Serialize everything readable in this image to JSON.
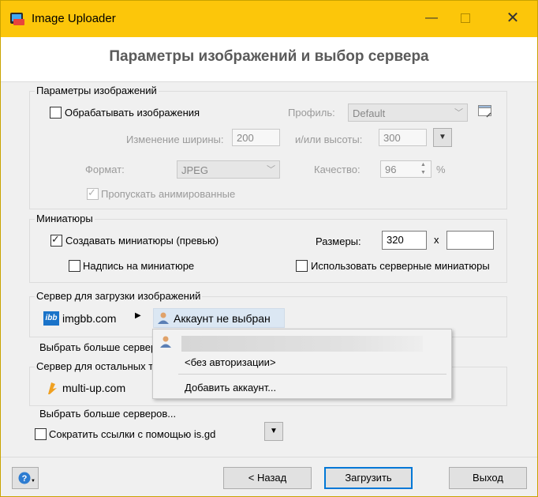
{
  "window": {
    "title": "Image Uploader",
    "minimize_icon": "minimize-icon",
    "maximize_icon": "maximize-icon",
    "close_icon": "close-icon"
  },
  "header": {
    "title": "Параметры изображений и выбор сервера"
  },
  "image_params": {
    "group_label": "Параметры изображений",
    "process_images": {
      "label": "Обрабатывать изображения",
      "checked": false
    },
    "profile_label": "Профиль:",
    "profile_value": "Default",
    "width_label": "Изменение ширины:",
    "width_value": "200",
    "height_label": "и/или высоты:",
    "height_value": "300",
    "format_label": "Формат:",
    "format_value": "JPEG",
    "quality_label": "Качество:",
    "quality_value": "96",
    "quality_unit": "%",
    "skip_animated": {
      "label": "Пропускать анимированные",
      "checked": true
    }
  },
  "thumbnails": {
    "group_label": "Миниатюры",
    "create_thumbs": {
      "label": "Создавать миниатюры (превью)",
      "checked": true
    },
    "sizes_label": "Размеры:",
    "size_width": "320",
    "size_sep": "x",
    "size_height": "",
    "caption": {
      "label": "Надпись на миниатюре",
      "checked": false
    },
    "server_thumbs": {
      "label": "Использовать серверные миниатюры",
      "checked": false
    }
  },
  "image_server": {
    "group_label": "Сервер для загрузки изображений",
    "server_name": "imgbb.com",
    "logo_text": "ibb",
    "account": "Аккаунт не выбран",
    "more_servers": "Выбрать больше серверов..."
  },
  "other_server": {
    "group_label": "Сервер для остальных типов файлов",
    "server_name": "multi-up.com",
    "more_servers": "Выбрать больше серверов..."
  },
  "shorten": {
    "label": "Сократить ссылки с помощью is.gd",
    "checked": false
  },
  "popup": {
    "no_auth": "<без авторизации>",
    "add_account": "Добавить аккаунт..."
  },
  "footer": {
    "back": "< Назад",
    "upload": "Загрузить",
    "exit": "Выход",
    "help_icon": "help-icon"
  },
  "colors": {
    "titlebar": "#fcc60a",
    "accent": "#0078d7",
    "logo_blue": "#1a73c9"
  }
}
